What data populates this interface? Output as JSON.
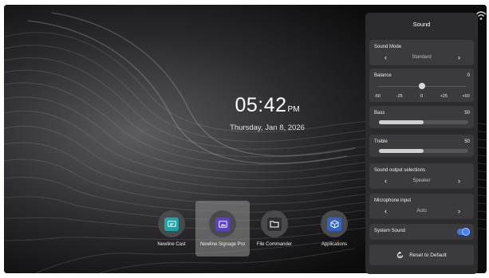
{
  "status": {
    "wifi_icon": "wifi-icon"
  },
  "clock": {
    "time": "05:42",
    "ampm": "PM",
    "date": "Thursday, Jan 8, 2026"
  },
  "dock": {
    "apps": [
      {
        "label": "Newline Cast",
        "icon": "cast-icon",
        "color": "#1aa6a6",
        "selected": false
      },
      {
        "label": "Newline Signage Pro",
        "icon": "signage-icon",
        "color": "#5b3fd0",
        "selected": true
      },
      {
        "label": "File Commander",
        "icon": "folder-icon",
        "color": "#2f2f33",
        "selected": false
      },
      {
        "label": "Applications",
        "icon": "apps-cube-icon",
        "color": "#2f64c9",
        "selected": false
      }
    ]
  },
  "sound_panel": {
    "title": "Sound",
    "sound_mode": {
      "label": "Sound Mode",
      "value": "Standard"
    },
    "balance": {
      "label": "Balance",
      "value": "0",
      "ticks": [
        "-50",
        "-25",
        "0",
        "+25",
        "+50"
      ]
    },
    "bass": {
      "label": "Bass",
      "value": "50",
      "level": 0.5
    },
    "treble": {
      "label": "Treble",
      "value": "50",
      "level": 0.5
    },
    "output": {
      "label": "Sound output selections",
      "value": "Speaker"
    },
    "microphone": {
      "label": "Microphone input",
      "value": "Auto"
    },
    "system_sound": {
      "label": "System Sound",
      "enabled": true
    },
    "reset": {
      "label": "Reset to Default",
      "icon": "reset-icon"
    }
  },
  "colors": {
    "panel_bg": "#2c2c2e",
    "card_bg": "#3b3b3d",
    "accent": "#3f83ff"
  }
}
